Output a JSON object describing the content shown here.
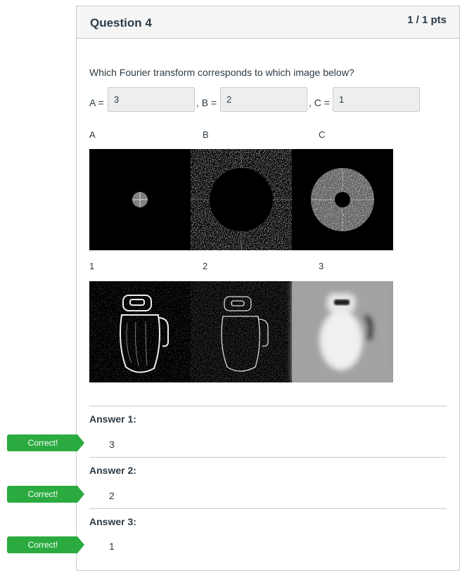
{
  "question": {
    "title": "Question 4",
    "points": "1 / 1 pts",
    "text": "Which Fourier transform corresponds to which image below?"
  },
  "inputs": {
    "a_label": "A =",
    "a_value": "3",
    "b_label": ", B =",
    "b_value": "2",
    "c_label": ", C =",
    "c_value": "1"
  },
  "figure": {
    "top_labels": [
      "A",
      "B",
      "C"
    ],
    "bottom_labels": [
      "1",
      "2",
      "3"
    ]
  },
  "answers": [
    {
      "title": "Answer 1:",
      "badge": "Correct!",
      "value": "3"
    },
    {
      "title": "Answer 2:",
      "badge": "Correct!",
      "value": "2"
    },
    {
      "title": "Answer 3:",
      "badge": "Correct!",
      "value": "1"
    }
  ],
  "colors": {
    "correct_badge": "#2bab3f",
    "header_bg": "#f5f5f5",
    "border": "#c7cdd1"
  }
}
